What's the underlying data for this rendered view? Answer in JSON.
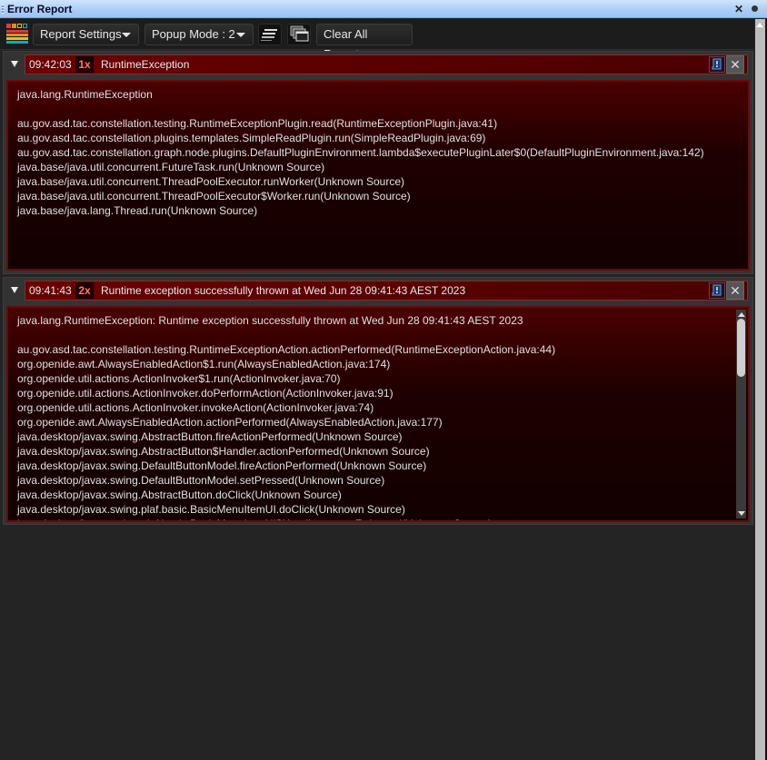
{
  "window": {
    "title": "Error Report",
    "close_icon": "close-icon",
    "pin_icon": "pin-icon"
  },
  "toolbar": {
    "logo_icon": "constellation-logo-icon",
    "report_settings_label": "Report Settings",
    "popup_mode_label": "Popup Mode : 2",
    "summary_icon": "collapse-all-icon",
    "windows_icon": "stacked-windows-icon",
    "clear_all_label": "Clear All Reports"
  },
  "colors": {
    "accent_red": "#6a0000",
    "count_text": "#ff7a5a",
    "background": "#242424"
  },
  "reports": [
    {
      "time": "09:42:03",
      "count": "1x",
      "summary": "RuntimeException",
      "expanded": true,
      "body": "java.lang.RuntimeException\n\nau.gov.asd.tac.constellation.testing.RuntimeExceptionPlugin.read(RuntimeExceptionPlugin.java:41)\nau.gov.asd.tac.constellation.plugins.templates.SimpleReadPlugin.run(SimpleReadPlugin.java:69)\nau.gov.asd.tac.constellation.graph.node.plugins.DefaultPluginEnvironment.lambda$executePluginLater$0(DefaultPluginEnvironment.java:142)\njava.base/java.util.concurrent.FutureTask.run(Unknown Source)\njava.base/java.util.concurrent.ThreadPoolExecutor.runWorker(Unknown Source)\njava.base/java.util.concurrent.ThreadPoolExecutor$Worker.run(Unknown Source)\njava.base/java.lang.Thread.run(Unknown Source)"
    },
    {
      "time": "09:41:43",
      "count": "2x",
      "summary": "Runtime exception successfully thrown at Wed Jun 28 09:41:43 AEST 2023",
      "expanded": true,
      "scroll_position": 0,
      "body": "java.lang.RuntimeException: Runtime exception successfully thrown at Wed Jun 28 09:41:43 AEST 2023\n\nau.gov.asd.tac.constellation.testing.RuntimeExceptionAction.actionPerformed(RuntimeExceptionAction.java:44)\norg.openide.awt.AlwaysEnabledAction$1.run(AlwaysEnabledAction.java:174)\norg.openide.util.actions.ActionInvoker$1.run(ActionInvoker.java:70)\norg.openide.util.actions.ActionInvoker.doPerformAction(ActionInvoker.java:91)\norg.openide.util.actions.ActionInvoker.invokeAction(ActionInvoker.java:74)\norg.openide.awt.AlwaysEnabledAction.actionPerformed(AlwaysEnabledAction.java:177)\njava.desktop/javax.swing.AbstractButton.fireActionPerformed(Unknown Source)\njava.desktop/javax.swing.AbstractButton$Handler.actionPerformed(Unknown Source)\njava.desktop/javax.swing.DefaultButtonModel.fireActionPerformed(Unknown Source)\njava.desktop/javax.swing.DefaultButtonModel.setPressed(Unknown Source)\njava.desktop/javax.swing.AbstractButton.doClick(Unknown Source)\njava.desktop/javax.swing.plaf.basic.BasicMenuItemUI.doClick(Unknown Source)\njava.desktop/javax.swing.plaf.basic.BasicMenuItemUI$Handler.mouseReleased(Unknown Source)"
    }
  ]
}
